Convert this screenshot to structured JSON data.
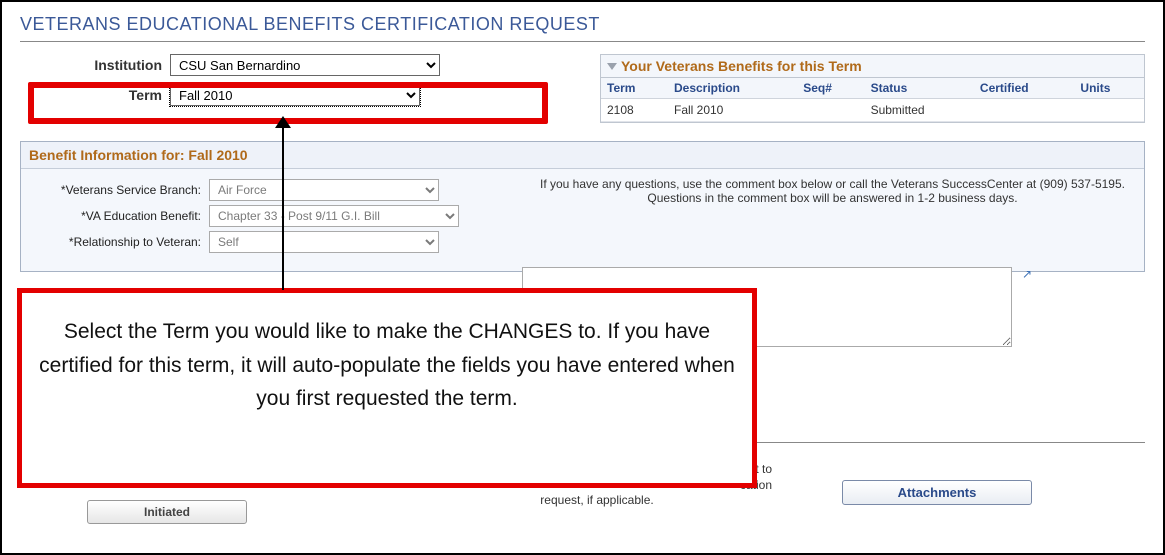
{
  "title": "VETERANS EDUCATIONAL BENEFITS CERTIFICATION REQUEST",
  "institution": {
    "label": "Institution",
    "value": "CSU San Bernardino"
  },
  "term": {
    "label": "Term",
    "value": "Fall 2010"
  },
  "benefits_panel": {
    "title": "Your Veterans Benefits for this Term",
    "columns": [
      "Term",
      "Description",
      "Seq#",
      "Status",
      "Certified",
      "Units"
    ],
    "row": {
      "term": "2108",
      "description": "Fall 2010",
      "seq": "",
      "status": "Submitted",
      "certified": "",
      "units": ""
    }
  },
  "section_title": "Benefit Information for: Fall 2010",
  "service_branch": {
    "label": "*Veterans Service Branch:",
    "value": "Air Force"
  },
  "va_benefit": {
    "label": "*VA Education Benefit:",
    "value": "Chapter 33 - Post 9/11 G.I. Bill"
  },
  "relationship": {
    "label": "*Relationship to Veteran:",
    "value": "Self"
  },
  "help_text": "If you have any questions, use the comment box below or call the Veterans SuccessCenter at (909) 537-5195. Questions in the comment box will be answered in 1-2 business days.",
  "attachments_btn": "Attachments",
  "initiated_btn": "Initiated",
  "truncated1": "pt to",
  "truncated2": "cation",
  "truncated3": "request, if applicable.",
  "callout_text": "Select the Term you would like to make the CHANGES to. If you have certified for this term,  it will auto-populate the fields you have entered when you first requested the term."
}
